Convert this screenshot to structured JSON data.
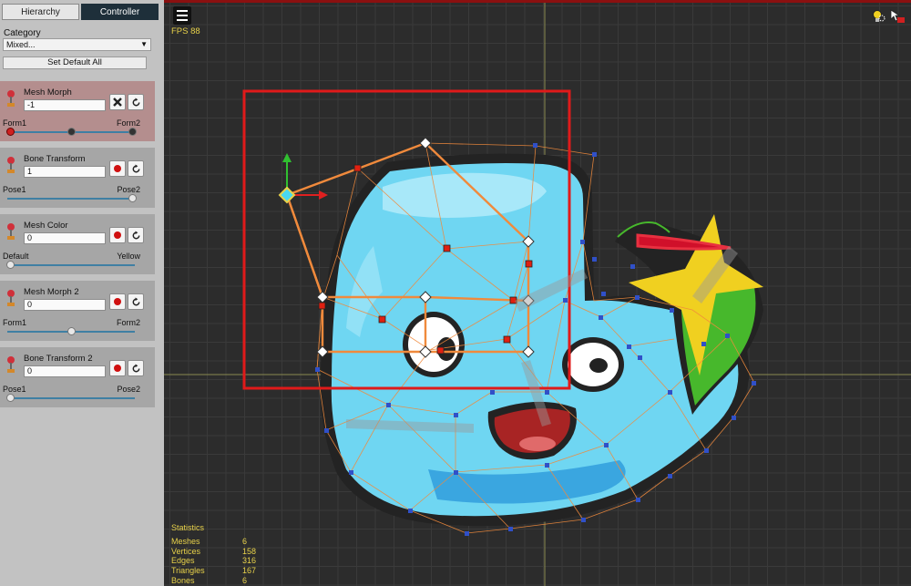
{
  "tabs": {
    "hierarchy": "Hierarchy",
    "controller": "Controller",
    "active": "controller"
  },
  "category": {
    "label": "Category",
    "selected": "Mixed..."
  },
  "set_default_all": "Set Default All",
  "controllers": [
    {
      "name": "Mesh Morph",
      "value": "-1",
      "min_label": "Form1",
      "max_label": "Form2",
      "slider_fraction": 0.0,
      "highlight": true,
      "first_button": "close-icon"
    },
    {
      "name": "Bone Transform",
      "value": "1",
      "min_label": "Pose1",
      "max_label": "Pose2",
      "slider_fraction": 1.0,
      "highlight": false,
      "first_button": "record-icon"
    },
    {
      "name": "Mesh Color",
      "value": "0",
      "min_label": "Default",
      "max_label": "Yellow",
      "slider_fraction": 0.0,
      "highlight": false,
      "first_button": "record-icon"
    },
    {
      "name": "Mesh Morph 2",
      "value": "0",
      "min_label": "Form1",
      "max_label": "Form2",
      "slider_fraction": 0.5,
      "highlight": false,
      "first_button": "record-icon"
    },
    {
      "name": "Bone Transform 2",
      "value": "0",
      "min_label": "Pose1",
      "max_label": "Pose2",
      "slider_fraction": 0.0,
      "highlight": false,
      "first_button": "record-icon"
    }
  ],
  "viewport": {
    "fps": "FPS 88",
    "statistics": {
      "title": "Statistics",
      "rows": [
        {
          "label": "Meshes",
          "value": "6"
        },
        {
          "label": "Vertices",
          "value": "158"
        },
        {
          "label": "Edges",
          "value": "316"
        },
        {
          "label": "Triangles",
          "value": "167"
        },
        {
          "label": "Bones",
          "value": "6"
        }
      ]
    }
  },
  "colors": {
    "accent_yellow": "#e8d24a",
    "selection_red": "#e01a1a",
    "bone_orange": "#f08a3c",
    "mesh_blue": "#3050c8",
    "slime_blue": "#6fd6f2",
    "panel_dark_tab": "#1e2f3a"
  }
}
